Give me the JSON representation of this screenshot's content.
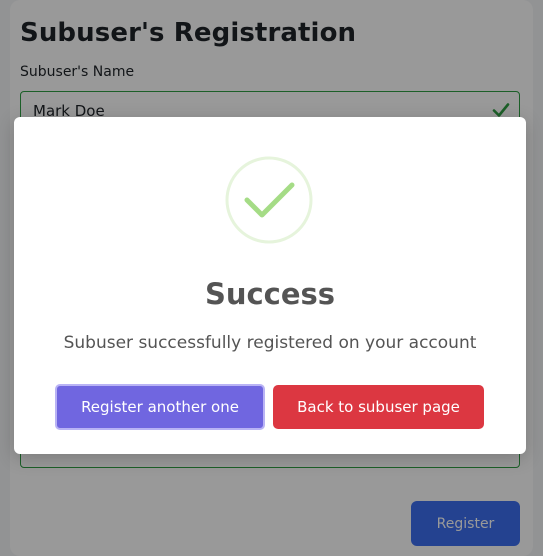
{
  "form": {
    "title": "Subuser's Registration",
    "name_label": "Subuser's Name",
    "name_value": "Mark Doe",
    "register_label": "Register"
  },
  "modal": {
    "title": "Success",
    "message": "Subuser successfully registered on your account",
    "primary_label": "Register another one",
    "secondary_label": "Back to subuser page"
  },
  "colors": {
    "valid_border": "#2f9e44",
    "register_button": "#3c6ef0",
    "primary_button": "#7066e0",
    "danger_button": "#dc3741",
    "success_icon": "#a5dc86"
  },
  "icons": {
    "valid": "check-icon",
    "select": "chevron-down-icon",
    "modal": "success-check-icon"
  }
}
